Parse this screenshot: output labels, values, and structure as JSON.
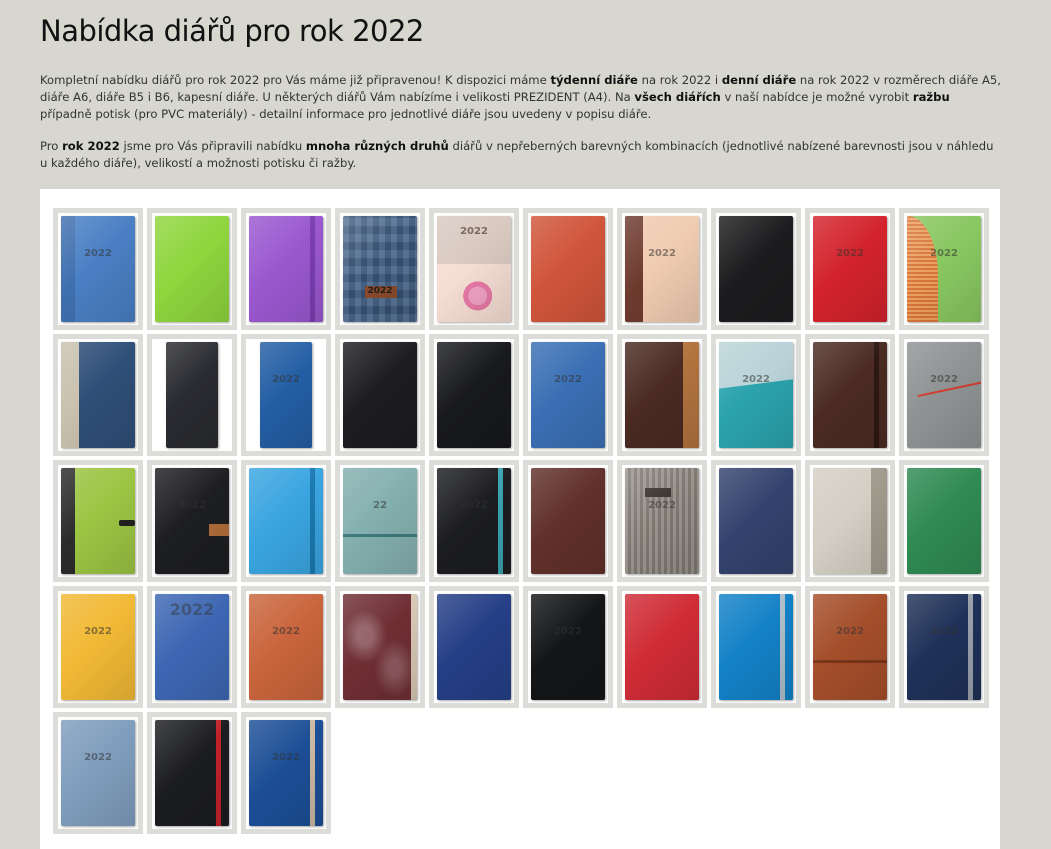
{
  "title": "Nabídka diářů pro rok 2022",
  "intro": {
    "p1": [
      {
        "t": "Kompletní nabídku diářů pro rok 2022 pro Vás máme již připravenou! K dispozici máme ",
        "b": false
      },
      {
        "t": "týdenní diáře",
        "b": true
      },
      {
        "t": " na rok 2022 i ",
        "b": false
      },
      {
        "t": "denní diáře",
        "b": true
      },
      {
        "t": " na rok 2022 v rozměrech diáře A5, diáře A6, diáře B5 i B6, kapesní diáře. U některých diářů Vám nabízíme i velikosti PREZIDENT (A4). Na ",
        "b": false
      },
      {
        "t": "všech diářích",
        "b": true
      },
      {
        "t": " v naší nabídce je možné vyrobit ",
        "b": false
      },
      {
        "t": "ražbu",
        "b": true
      },
      {
        "t": " případně potisk (pro PVC materiály) - detailní informace pro jednotlivé diáře jsou uvedeny v popisu diáře.",
        "b": false
      }
    ],
    "p2": [
      {
        "t": "Pro ",
        "b": false
      },
      {
        "t": "rok 2022",
        "b": true
      },
      {
        "t": " jsme pro Vás připravili nabídku ",
        "b": false
      },
      {
        "t": "mnoha různých druhů",
        "b": true
      },
      {
        "t": " diářů v nepřeberných barevných kombinacích (jednotlivé nabízené barevnosti jsou v náhledu u každého diáře), velikostí a možnosti potisku či ražby.",
        "b": false
      }
    ]
  },
  "diaries": [
    {
      "color": "#4a7fc4",
      "spine": "#3f6fae",
      "year": "2022",
      "style": "spine-left"
    },
    {
      "color": "#8fd63e",
      "spine": "#7fc435",
      "year": "",
      "style": "plain"
    },
    {
      "color": "#9a58cf",
      "spine": "#8447b8",
      "year": "",
      "style": "strap-right",
      "strap": "#7b3fb0"
    },
    {
      "color": "#3f5f86",
      "spine": "#2d4a6d",
      "year": "2022",
      "style": "denim",
      "label": "#8a4a2c"
    },
    {
      "color": "#d8c9c0",
      "spine": "#a9896f",
      "year": "2022",
      "style": "flower"
    },
    {
      "color": "#d0553a",
      "spine": "#b8472f",
      "year": "",
      "style": "plain"
    },
    {
      "color": "#f0cbb0",
      "spine": "#6e3a2e",
      "year": "2022",
      "style": "spine-left-wide"
    },
    {
      "color": "#1c1c1e",
      "spine": "#2b2b2d",
      "year": "",
      "style": "plain"
    },
    {
      "color": "#d3232c",
      "spine": "#b81d25",
      "year": "2022",
      "style": "plain"
    },
    {
      "color": "#89c760",
      "spine": "#d8733a",
      "year": "2022",
      "style": "wave"
    },
    {
      "color": "#2f4f78",
      "spine": "#c9c0ad",
      "year": "",
      "style": "spine-left-wide"
    },
    {
      "color": "#2a2b30",
      "spine": "#3a3b40",
      "year": "",
      "style": "narrow"
    },
    {
      "color": "#235ea4",
      "spine": "#1d4e8a",
      "year": "2022",
      "style": "narrow"
    },
    {
      "color": "#1d1d20",
      "spine": "#2b2b2f",
      "year": "",
      "style": "plain"
    },
    {
      "color": "#18191c",
      "spine": "#2a2a2e",
      "year": "",
      "style": "plain"
    },
    {
      "color": "#3a6fb4",
      "spine": "#2e5f9e",
      "year": "2022",
      "style": "plain"
    },
    {
      "color": "#4a2a22",
      "spine": "#b2733f",
      "year": "",
      "style": "spine-right-wide"
    },
    {
      "color": "#2ba3ad",
      "spine": "#b9d3d8",
      "year": "2022",
      "style": "split"
    },
    {
      "color": "#4b2b23",
      "spine": "#3c2119",
      "year": "",
      "style": "strap-right",
      "strap": "#2d1812"
    },
    {
      "color": "#8f9393",
      "spine": "#d23b2c",
      "year": "2022",
      "style": "slash"
    },
    {
      "color": "#9cc443",
      "spine": "#2b2b2b",
      "year": "",
      "style": "spine-left",
      "strap": "#222"
    },
    {
      "color": "#1d1e21",
      "spine": "#b06d3a",
      "year": "2022",
      "style": "label-right"
    },
    {
      "color": "#3aa5e0",
      "spine": "#2a8dc7",
      "year": "",
      "style": "strap-right",
      "strap": "#1c7ab2"
    },
    {
      "color": "#84afaf",
      "spine": "#4d8e90",
      "year": "22",
      "style": "band-h",
      "strap": "#3f7a7c"
    },
    {
      "color": "#1c1d20",
      "spine": "#3aa2b0",
      "year": "2022",
      "style": "strap-right",
      "strap": "#3aa2b0"
    },
    {
      "color": "#61302a",
      "spine": "#4f2621",
      "year": "",
      "style": "plain"
    },
    {
      "color": "#8b857d",
      "spine": "#76706a",
      "year": "2022",
      "style": "wood"
    },
    {
      "color": "#34436e",
      "spine": "#c7a28a",
      "year": "",
      "style": "plain"
    },
    {
      "color": "#d4cfc4",
      "spine": "#a19b8e",
      "year": "",
      "style": "spine-right-wide"
    },
    {
      "color": "#2f8a52",
      "spine": "#276f43",
      "year": "",
      "style": "plain"
    },
    {
      "color": "#f1b935",
      "spine": "#d9a22a",
      "year": "2022",
      "style": "plain"
    },
    {
      "color": "#3d67b3",
      "spine": "#32599c",
      "year": "2022",
      "style": "bigyear"
    },
    {
      "color": "#c9653c",
      "spine": "#b65832",
      "year": "2022",
      "style": "plain"
    },
    {
      "color": "#6e2e34",
      "spine": "#d8c9b4",
      "year": "",
      "style": "marble"
    },
    {
      "color": "#253f86",
      "spine": "#1c3270",
      "year": "",
      "style": "plain"
    },
    {
      "color": "#131517",
      "spine": "#252729",
      "year": "2022",
      "style": "plain"
    },
    {
      "color": "#cf2c36",
      "spine": "#b5242d",
      "year": "",
      "style": "plain"
    },
    {
      "color": "#1381c6",
      "spine": "#c8d4dc",
      "year": "",
      "style": "strap-right",
      "strap": "#aebfca"
    },
    {
      "color": "#a44e2a",
      "spine": "#8f4022",
      "year": "2022",
      "style": "band-h",
      "strap": "#7a341a"
    },
    {
      "color": "#1f3158",
      "spine": "#8a8e98",
      "year": "2022",
      "style": "strap-right",
      "strap": "#9aa0ab"
    },
    {
      "color": "#7f9dbd",
      "spine": "#6a89a9",
      "year": "2022",
      "style": "plain"
    },
    {
      "color": "#1b1c1f",
      "spine": "#c2222a",
      "year": "",
      "style": "strap-right",
      "strap": "#c2222a"
    },
    {
      "color": "#1c4e96",
      "spine": "#c7b9a6",
      "year": "2022",
      "style": "strap-right",
      "strap": "#cbb9a2"
    }
  ]
}
